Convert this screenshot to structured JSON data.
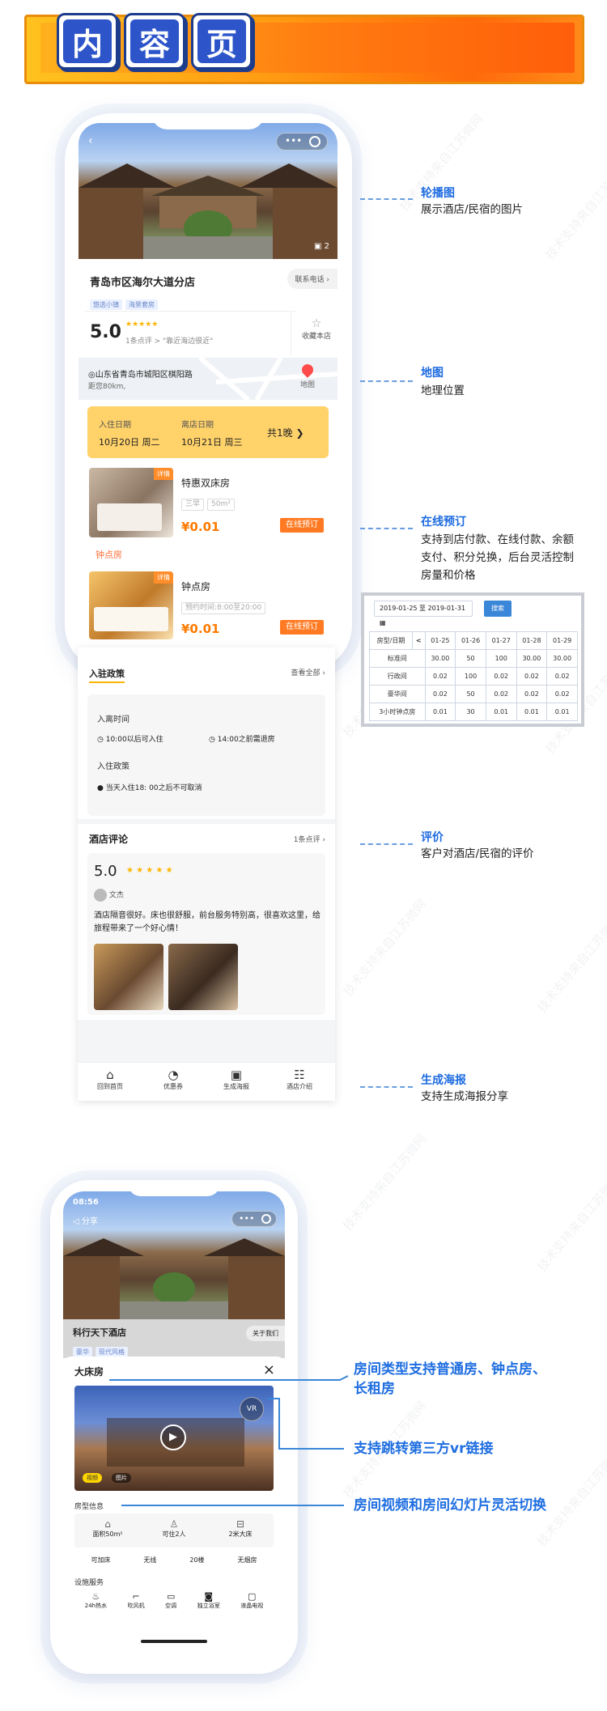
{
  "header": {
    "tiles": [
      "内",
      "容",
      "页"
    ]
  },
  "phone1": {
    "hotel": {
      "name": "青岛市区海尔大道分店",
      "tags": [
        "悠选小镇",
        "海景套房"
      ],
      "contact": "联系电话",
      "rating": "5.0",
      "review_summary": "1条点评 > \"靠近海边很近\"",
      "favorite": "收藏本店",
      "photo_count": "2",
      "address": "山东省青岛市城阳区棋阳路",
      "distance": "距您80km,",
      "map_label": "地图"
    },
    "dates": {
      "checkin_label": "入住日期",
      "checkout_label": "离店日期",
      "checkin": "10月20日",
      "checkin_day": "周二",
      "checkout": "10月21日",
      "checkout_day": "周三",
      "nights": "共1晚"
    },
    "rooms": [
      {
        "name": "特惠双床房",
        "badge": "详情",
        "tags": [
          "三早",
          "50m²"
        ],
        "price": "¥0.01",
        "btn": "在线预订"
      },
      {
        "name": "钟点房",
        "badge": "详情",
        "tags": [
          "预约时间:8:00至20:00"
        ],
        "price": "¥0.01",
        "btn": "在线预订"
      }
    ],
    "hourly_section": "钟点房",
    "policy": {
      "title": "入驻政策",
      "view_all": "查看全部",
      "inout_title": "入离时间",
      "checkin_time": "10:00以后可入住",
      "checkout_time": "14:00之前需退房",
      "stay_title": "入住政策",
      "stay_rule": "当天入住18: 00之后不可取消"
    },
    "reviews": {
      "title": "酒店评论",
      "count": "1条点评",
      "score": "5.0",
      "user": "文杰",
      "text": "酒店隔音很好。床也很舒服，前台服务特别高，很喜欢这里，给旅程带来了一个好心情！"
    },
    "tabbar": [
      "回到首页",
      "优惠券",
      "生成海报",
      "酒店介绍"
    ]
  },
  "annotations": [
    {
      "title": "轮播图",
      "desc": "展示酒店/民宿的图片"
    },
    {
      "title": "地图",
      "desc": "地理位置"
    },
    {
      "title": "在线预订",
      "desc": "支持到店付款、在线付款、余额支付、积分兑换，后台灵活控制房量和价格"
    },
    {
      "title": "评价",
      "desc": "客户对酒店/民宿的评价"
    },
    {
      "title": "生成海报",
      "desc": "支持生成海报分享"
    }
  ],
  "calendar": {
    "range": "2019-01-25 至 2019-01-31",
    "search": "搜索",
    "header": [
      "房型/日期",
      "<",
      "01-25",
      "01-26",
      "01-27",
      "01-28",
      "01-29"
    ],
    "rows": [
      [
        "标准间",
        "30.00",
        "50",
        "100",
        "30.00",
        "30.00"
      ],
      [
        "行政间",
        "0.02",
        "100",
        "0.02",
        "0.02",
        "0.02"
      ],
      [
        "豪华间",
        "0.02",
        "50",
        "0.02",
        "0.02",
        "0.02"
      ],
      [
        "3小时钟点房",
        "0.01",
        "30",
        "0.01",
        "0.01",
        "0.01"
      ]
    ]
  },
  "phone2": {
    "time": "08:56",
    "share": "分享",
    "hotel_name": "科行天下酒店",
    "tags": [
      "豪华",
      "现代风格"
    ],
    "follow": "关于我们",
    "room_title": "大床房",
    "vr": "VR",
    "media_tabs": [
      "视频",
      "图片"
    ],
    "info_title": "房型信息",
    "info": [
      {
        "icon": "house-icon",
        "label": "面积50m²"
      },
      {
        "icon": "person-icon",
        "label": "可住2人"
      },
      {
        "icon": "bed-icon",
        "label": "2米大床"
      }
    ],
    "extras": [
      "可加床",
      "无线",
      "20楼",
      "无烟房"
    ],
    "facility_title": "设施服务",
    "facilities": [
      {
        "icon": "hot-water-icon",
        "label": "24h热水"
      },
      {
        "icon": "hair-dryer-icon",
        "label": "吹风机"
      },
      {
        "icon": "air-conditioner-icon",
        "label": "空调"
      },
      {
        "icon": "bathroom-icon",
        "label": "独立浴室"
      },
      {
        "icon": "tv-icon",
        "label": "液晶电视"
      }
    ]
  },
  "callouts": [
    "房间类型支持普通房、钟点房、长租房",
    "支持跳转第三方vr链接",
    "房间视频和房间幻灯片灵活切换"
  ],
  "watermark": "技术支持来自江苏微网"
}
